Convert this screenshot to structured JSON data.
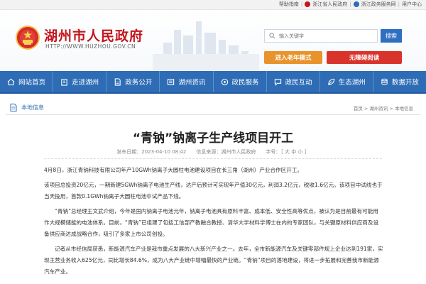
{
  "topbar": {
    "links": [
      "帮助指南",
      "浙江省人民政府",
      "浙江政务服务网",
      "用户中心"
    ]
  },
  "header": {
    "title": "湖州市人民政府",
    "url": "HTTP://WWW.HUZHOU.GOV.CN",
    "search_placeholder": "输入关键字",
    "search_button": "搜索",
    "elder_mode": "进入老年模式",
    "accessible_mode": "无障碍阅读"
  },
  "nav": {
    "items": [
      {
        "label": "网站首页",
        "icon": "home-icon"
      },
      {
        "label": "走进湖州",
        "icon": "building-icon"
      },
      {
        "label": "政务公开",
        "icon": "document-icon"
      },
      {
        "label": "湖州资讯",
        "icon": "news-icon"
      },
      {
        "label": "政民服务",
        "icon": "service-icon"
      },
      {
        "label": "政民互动",
        "icon": "chat-icon"
      },
      {
        "label": "生态湖州",
        "icon": "leaf-icon"
      },
      {
        "label": "数据开放",
        "icon": "data-icon"
      }
    ]
  },
  "breadcrumb": {
    "section": "本地信息",
    "path": "首页 > 湖州资讯 > 本地信息"
  },
  "article": {
    "title": "“青钠”钠离子生产线项目开工",
    "meta": "发布日期：2023-04-10 08:42　　信息来源：湖州市人民政府　　字号：［ 大 中 小 ］",
    "paragraphs": [
      "4月8日，浙江青钠科技有限公司年产10GWh钠离子大圆柱电池建设项目在长三角（湖州）产业合作区开工。",
      "该项目总投资20亿元，一期新建5GWh钠离子电池生产线，达产后预计可实现年产值30亿元，利润3.2亿元，税收1.6亿元。该项目中试线也于当天投用，首款0.1GWh钠离子大圆柱电池中试产品下线。",
      "“青钠”总经理王文武介绍，今年是国内钠离子电池元年，钠离子电池具有原料丰富、成本低、安全性高等优点，被认为是目前最有可能用作大规模储能的电池体系。目前，“青钠”已组建了包括工信部产教融合教授、清华大学材料学博士在内的专家团队，与关键原材料供应商及设备供应商达成战略合作，吸引了多家上市公司创投。",
      "记者从市经信局获悉，新能源汽车产业是我市重点发展的八大新兴产业之一。去年，全市新能源汽车及关键零部件规上企业达到191家，实现主营业务收入625亿元，同比增长84.6%，成为八大产业链中增幅最快的产业链。“青钠”项目的落地建设，将进一步拓展和完善我市新能源汽车产业。"
    ]
  },
  "colors": {
    "brand_red": "#c4161c",
    "nav_blue": "#2e6cb5",
    "elder_orange": "#e8932b",
    "accessible_red": "#d8342c"
  }
}
